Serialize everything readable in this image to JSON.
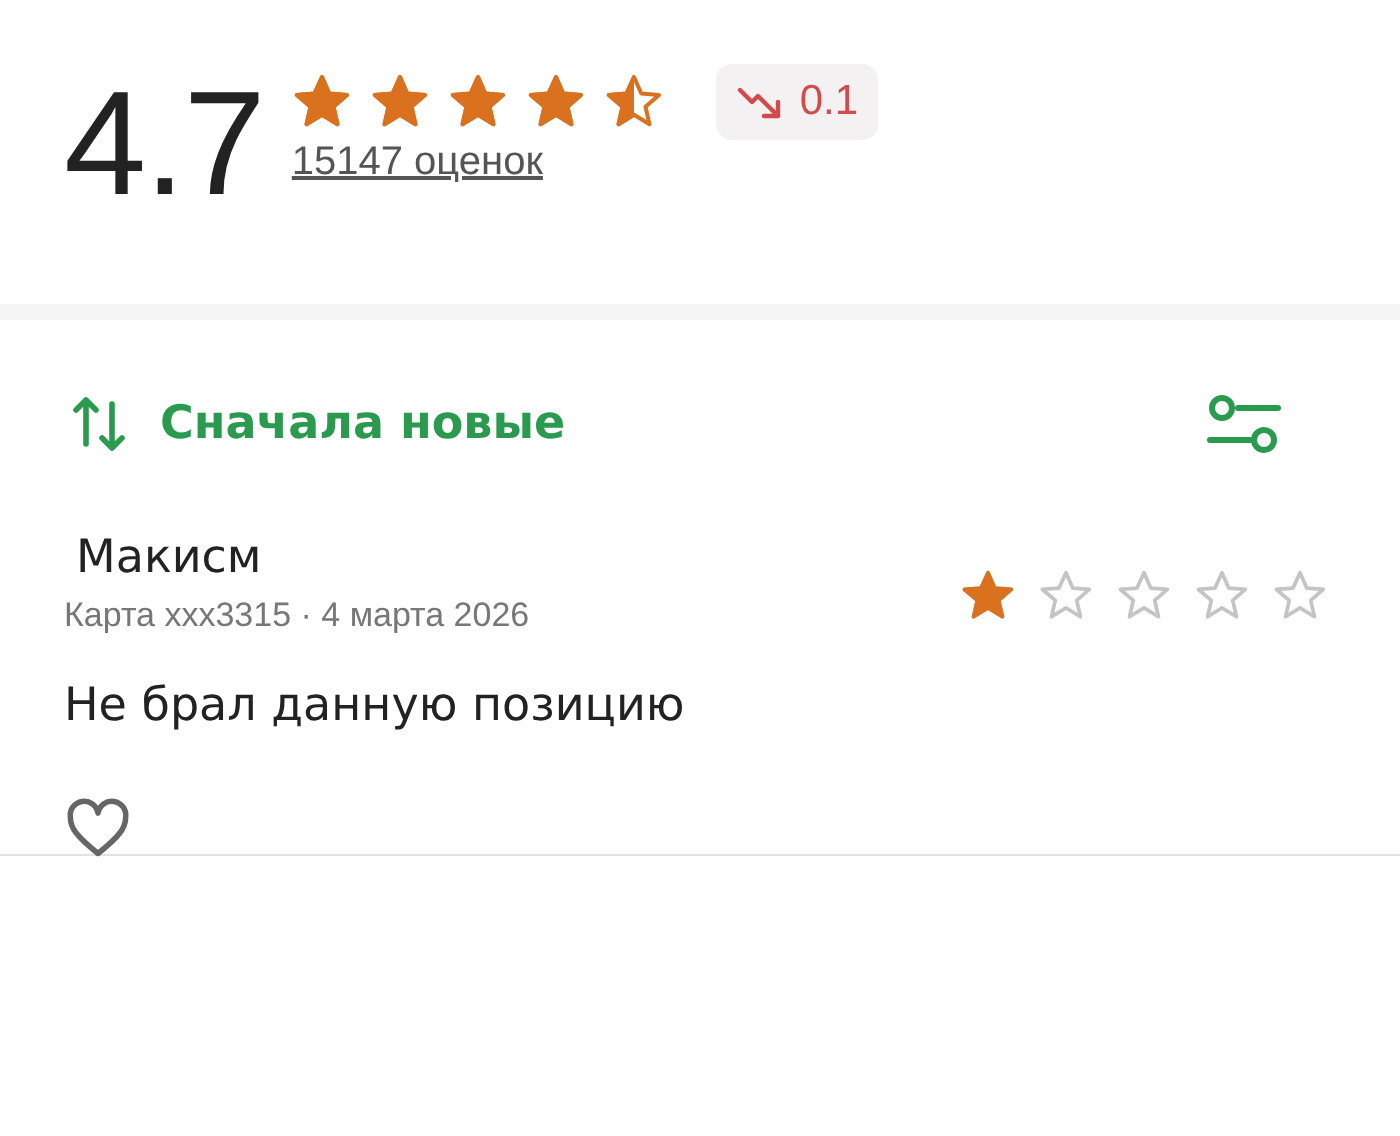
{
  "summary": {
    "rating": "4.7",
    "stars": 4.5,
    "count_link": "15147 оценок",
    "trend": {
      "falling": true,
      "value": "0.1"
    }
  },
  "sort": {
    "label": "Сначала новые"
  },
  "reviews": [
    {
      "author": "Макисм",
      "meta": "Карта xxx3315 · 4 марта 2026",
      "stars": 1,
      "text": "Не брал данную позицию",
      "liked": false
    }
  ]
}
